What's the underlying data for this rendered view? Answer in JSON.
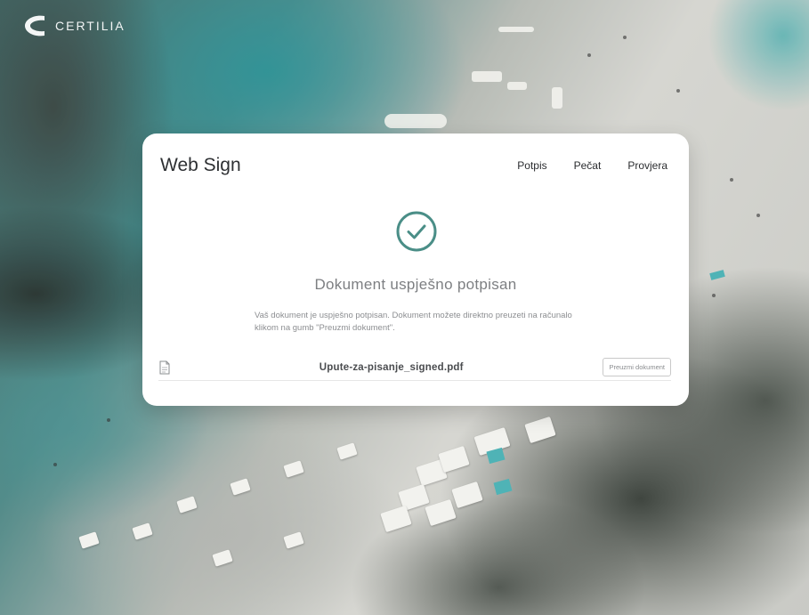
{
  "brand": {
    "name": "CERTILIA"
  },
  "card": {
    "title": "Web Sign",
    "nav": [
      "Potpis",
      "Pečat",
      "Provjera"
    ],
    "success_title": "Dokument uspješno potpisan",
    "success_desc": "Vaš dokument je uspješno potpisan. Dokument možete direktno preuzeti na računalo klikom na gumb \"Preuzmi dokument\".",
    "file_name": "Upute-za-pisanje_signed.pdf",
    "download_label": "Preuzmi dokument"
  },
  "colors": {
    "accent_success": "#4a8e87",
    "card_bg": "#ffffff"
  },
  "icons": [
    "certilia-logo-icon",
    "check-circle-icon",
    "document-icon"
  ]
}
